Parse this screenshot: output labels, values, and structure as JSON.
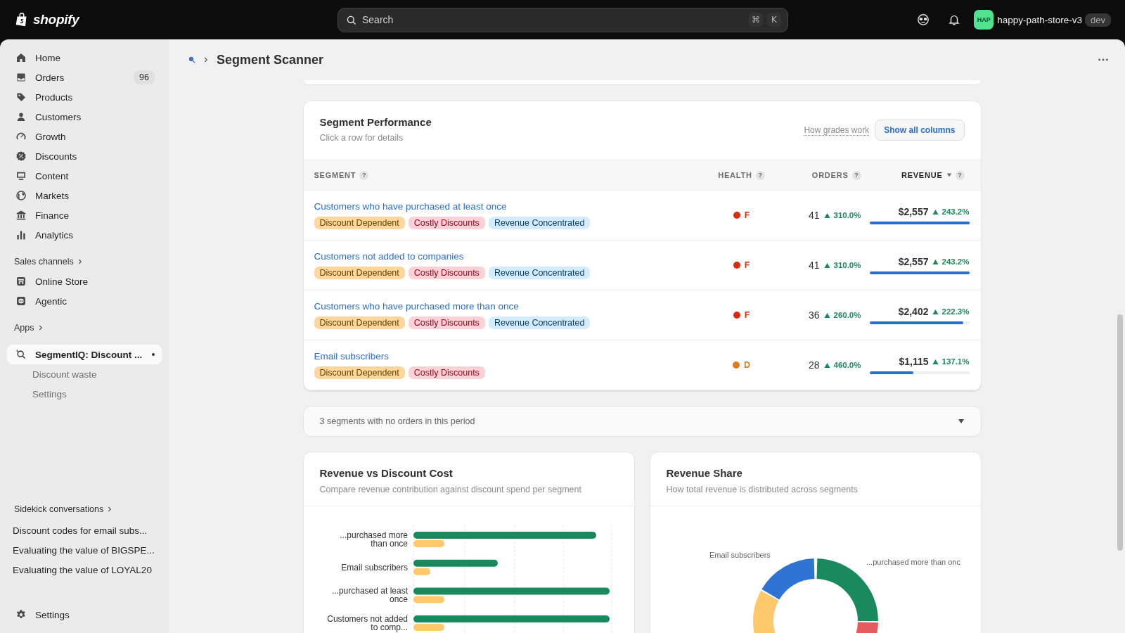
{
  "topbar": {
    "logo": "shopify",
    "search": {
      "placeholder": "Search",
      "keys": [
        "⌘",
        "K"
      ]
    },
    "store": {
      "avatar": "HAP",
      "name": "happy-path-store-v3",
      "badge": "dev"
    }
  },
  "sidebar": {
    "items": [
      {
        "label": "Home",
        "selected": false
      },
      {
        "label": "Orders",
        "badge": "96",
        "selected": false
      },
      {
        "label": "Products",
        "selected": false
      },
      {
        "label": "Customers",
        "selected": false
      },
      {
        "label": "Growth",
        "selected": false
      },
      {
        "label": "Discounts",
        "selected": false
      },
      {
        "label": "Content",
        "selected": false
      },
      {
        "label": "Markets",
        "selected": false
      },
      {
        "label": "Finance",
        "selected": false
      },
      {
        "label": "Analytics",
        "selected": false
      }
    ],
    "sales_channels": {
      "heading": "Sales channels",
      "items": [
        {
          "label": "Online Store",
          "selected": false
        },
        {
          "label": "Agentic",
          "selected": false
        }
      ]
    },
    "apps": {
      "heading": "Apps",
      "items": [
        {
          "label": "SegmentIQ: Discount ...",
          "selected": true,
          "children": [
            {
              "label": "Discount waste",
              "selected": false
            },
            {
              "label": "Settings",
              "selected": false
            }
          ]
        }
      ]
    },
    "sidekick": {
      "heading": "Sidekick conversations",
      "items": [
        "Discount codes for email subs...",
        "Evaluating the value of BIGSPE...",
        "Evaluating the value of LOYAL20"
      ]
    },
    "footer": {
      "label": "Settings"
    }
  },
  "page": {
    "title": "Segment Scanner"
  },
  "performance": {
    "title": "Segment Performance",
    "subtitle": "Click a row for details",
    "link": "How grades work",
    "button": "Show all columns",
    "columns": [
      {
        "label": "SEGMENT",
        "help": "?",
        "sorted": false
      },
      {
        "label": "HEALTH",
        "help": "?",
        "sorted": false
      },
      {
        "label": "ORDERS",
        "help": "?",
        "sorted": false
      },
      {
        "label": "REVENUE",
        "help": "?",
        "sorted": true
      }
    ],
    "rows": [
      {
        "name": "Customers who have purchased at least once",
        "tags": [
          {
            "label": "Discount Dependent",
            "kind": "dependent"
          },
          {
            "label": "Costly Discounts",
            "kind": "costly"
          },
          {
            "label": "Revenue Concentrated",
            "kind": "concentrated"
          }
        ],
        "health": {
          "grade": "F",
          "color": "#d82c0d"
        },
        "orders": "41",
        "orders_change": "310.0%",
        "revenue": "$2,557",
        "revenue_change": "243.2%",
        "level": 1
      },
      {
        "name": "Customers not added to companies",
        "tags": [
          {
            "label": "Discount Dependent",
            "kind": "dependent"
          },
          {
            "label": "Costly Discounts",
            "kind": "costly"
          },
          {
            "label": "Revenue Concentrated",
            "kind": "concentrated"
          }
        ],
        "health": {
          "grade": "F",
          "color": "#d82c0d"
        },
        "orders": "41",
        "orders_change": "310.0%",
        "revenue": "$2,557",
        "revenue_change": "243.2%",
        "level": 1
      },
      {
        "name": "Customers who have purchased more than once",
        "tags": [
          {
            "label": "Discount Dependent",
            "kind": "dependent"
          },
          {
            "label": "Costly Discounts",
            "kind": "costly"
          },
          {
            "label": "Revenue Concentrated",
            "kind": "concentrated"
          }
        ],
        "health": {
          "grade": "F",
          "color": "#d82c0d"
        },
        "orders": "36",
        "orders_change": "260.0%",
        "revenue": "$2,402",
        "revenue_change": "222.3%",
        "level": 0.94
      },
      {
        "name": "Email subscribers",
        "tags": [
          {
            "label": "Discount Dependent",
            "kind": "dependent"
          },
          {
            "label": "Costly Discounts",
            "kind": "costly"
          }
        ],
        "health": {
          "grade": "D",
          "color": "#e07b22"
        },
        "orders": "28",
        "orders_change": "460.0%",
        "revenue": "$1,115",
        "revenue_change": "137.1%",
        "level": 0.44
      }
    ]
  },
  "no_orders": {
    "text": "3 segments with no orders in this period",
    "expanded": false
  },
  "revenue_vs_discount": {
    "title": "Revenue vs Discount Cost",
    "subtitle": "Compare revenue contribution against discount spend per segment",
    "labels": [
      [
        "...purchased more",
        "than once"
      ],
      [
        "Email subscribers"
      ],
      [
        "...purchased at least",
        "once"
      ],
      [
        "Customers not added",
        "to comp..."
      ]
    ]
  },
  "revenue_share": {
    "title": "Revenue Share",
    "subtitle": "How total revenue is distributed across segments",
    "labels": [
      "Email subscribers",
      "...purchased more than onc"
    ]
  }
}
